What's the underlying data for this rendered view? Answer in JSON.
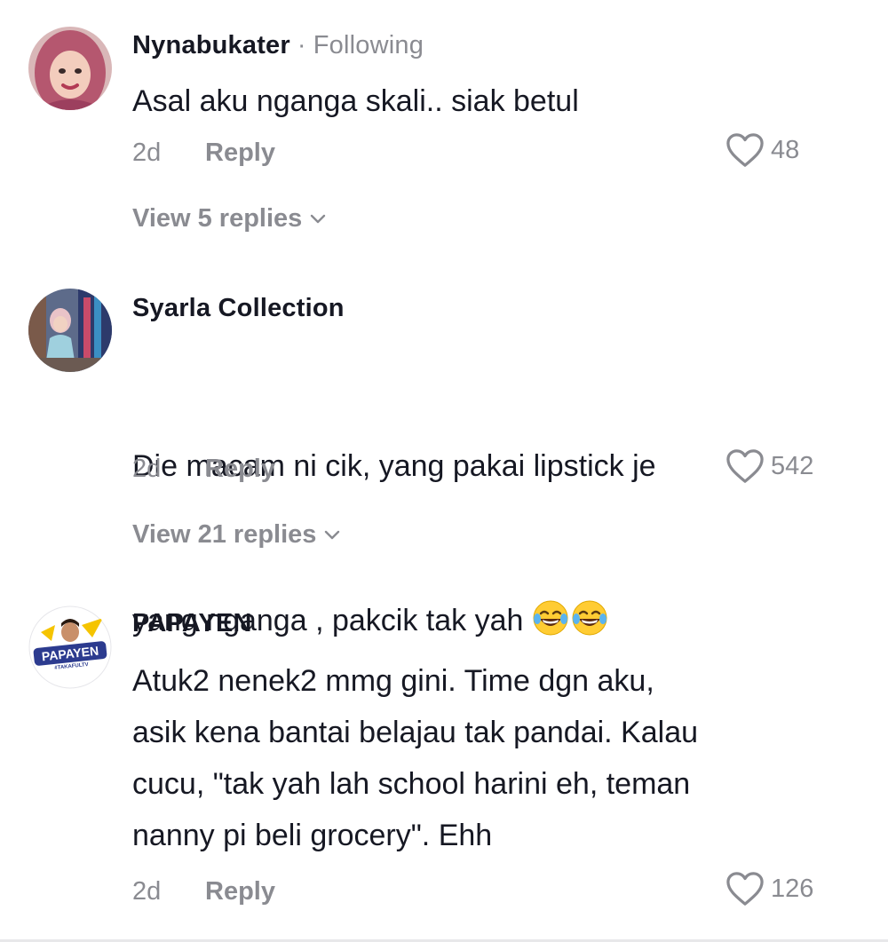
{
  "comments": [
    {
      "author": "Nynabukater",
      "separator": "·",
      "following_label": "Following",
      "text": "Asal aku nganga skali.. siak betul",
      "time": "2d",
      "reply_label": "Reply",
      "likes": "48",
      "view_replies": "View 5 replies",
      "avatar_icon": "profile-photo-hijab-pink"
    },
    {
      "author": "Syarla Collection",
      "text_line1": "Die macam ni cik, yang pakai lipstick je",
      "text_line2": "yang nganga , pakcik tak yah",
      "emojis": [
        "😂",
        "😂"
      ],
      "time": "2d",
      "reply_label": "Reply",
      "likes": "542",
      "view_replies": "View 21 replies",
      "avatar_icon": "profile-photo-child-store"
    },
    {
      "author": "PAPAYEN",
      "text": "Atuk2 nenek2 mmg gini. Time dgn aku,\nasik kena bantai belajau tak pandai. Kalau\ncucu, \"tak yah lah school harini eh, teman\nnanny pi beli grocery\". Ehh",
      "time": "2d",
      "reply_label": "Reply",
      "likes": "126",
      "avatar_icon": "papayen-logo",
      "avatar_logo_text": "PAPAYEN",
      "avatar_logo_subtext": "#TAKAFULTV"
    }
  ],
  "colors": {
    "primary_text": "#161823",
    "secondary_text": "#8a8b91",
    "background": "#ffffff"
  }
}
